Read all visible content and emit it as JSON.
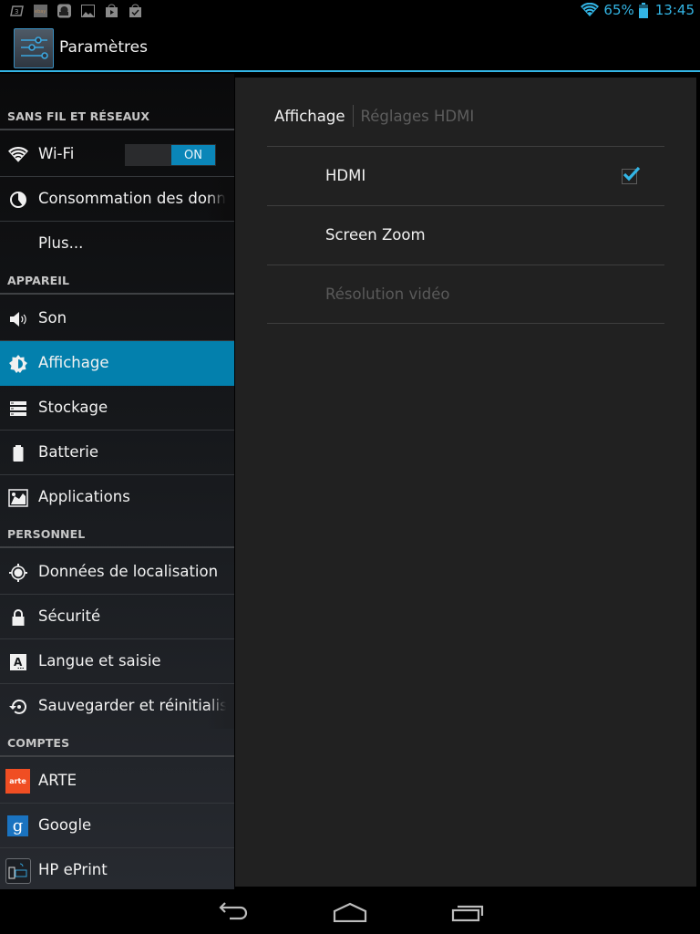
{
  "status_bar": {
    "notification_icons": [
      "sd-card-icon",
      "ebay-icon",
      "sync-app-icon",
      "image-icon",
      "play-store-update-icon",
      "play-store-done-icon"
    ],
    "wifi": "wifi-full-icon",
    "battery_percent": "65%",
    "time": "13:45",
    "accent_color": "#33b5e5"
  },
  "action_bar": {
    "title": "Paramètres"
  },
  "sidebar": {
    "sections": [
      {
        "label": "SANS FIL ET RÉSEAUX"
      },
      {
        "label": "APPAREIL"
      },
      {
        "label": "PERSONNEL"
      },
      {
        "label": "COMPTES"
      }
    ],
    "wifi": {
      "label": "Wi-Fi",
      "toggle": "ON"
    },
    "items": [
      {
        "label": "Consommation des données"
      },
      {
        "label": "Plus..."
      },
      {
        "label": "Son"
      },
      {
        "label": "Affichage",
        "selected": true
      },
      {
        "label": "Stockage"
      },
      {
        "label": "Batterie"
      },
      {
        "label": "Applications"
      },
      {
        "label": "Données de localisation"
      },
      {
        "label": "Sécurité"
      },
      {
        "label": "Langue et saisie"
      },
      {
        "label": "Sauvegarder et réinitialiser"
      },
      {
        "label": "ARTE"
      },
      {
        "label": "Google"
      },
      {
        "label": "HP ePrint"
      }
    ],
    "selected_color": "#0380ad"
  },
  "content": {
    "breadcrumb": {
      "parent": "Affichage",
      "current": "Réglages HDMI"
    },
    "prefs": [
      {
        "title": "HDMI",
        "checked": true
      },
      {
        "title": "Screen Zoom"
      },
      {
        "title": "Résolution vidéo",
        "enabled": false
      }
    ]
  },
  "nav_bar": {
    "buttons": [
      "back",
      "home",
      "recent-apps"
    ]
  }
}
